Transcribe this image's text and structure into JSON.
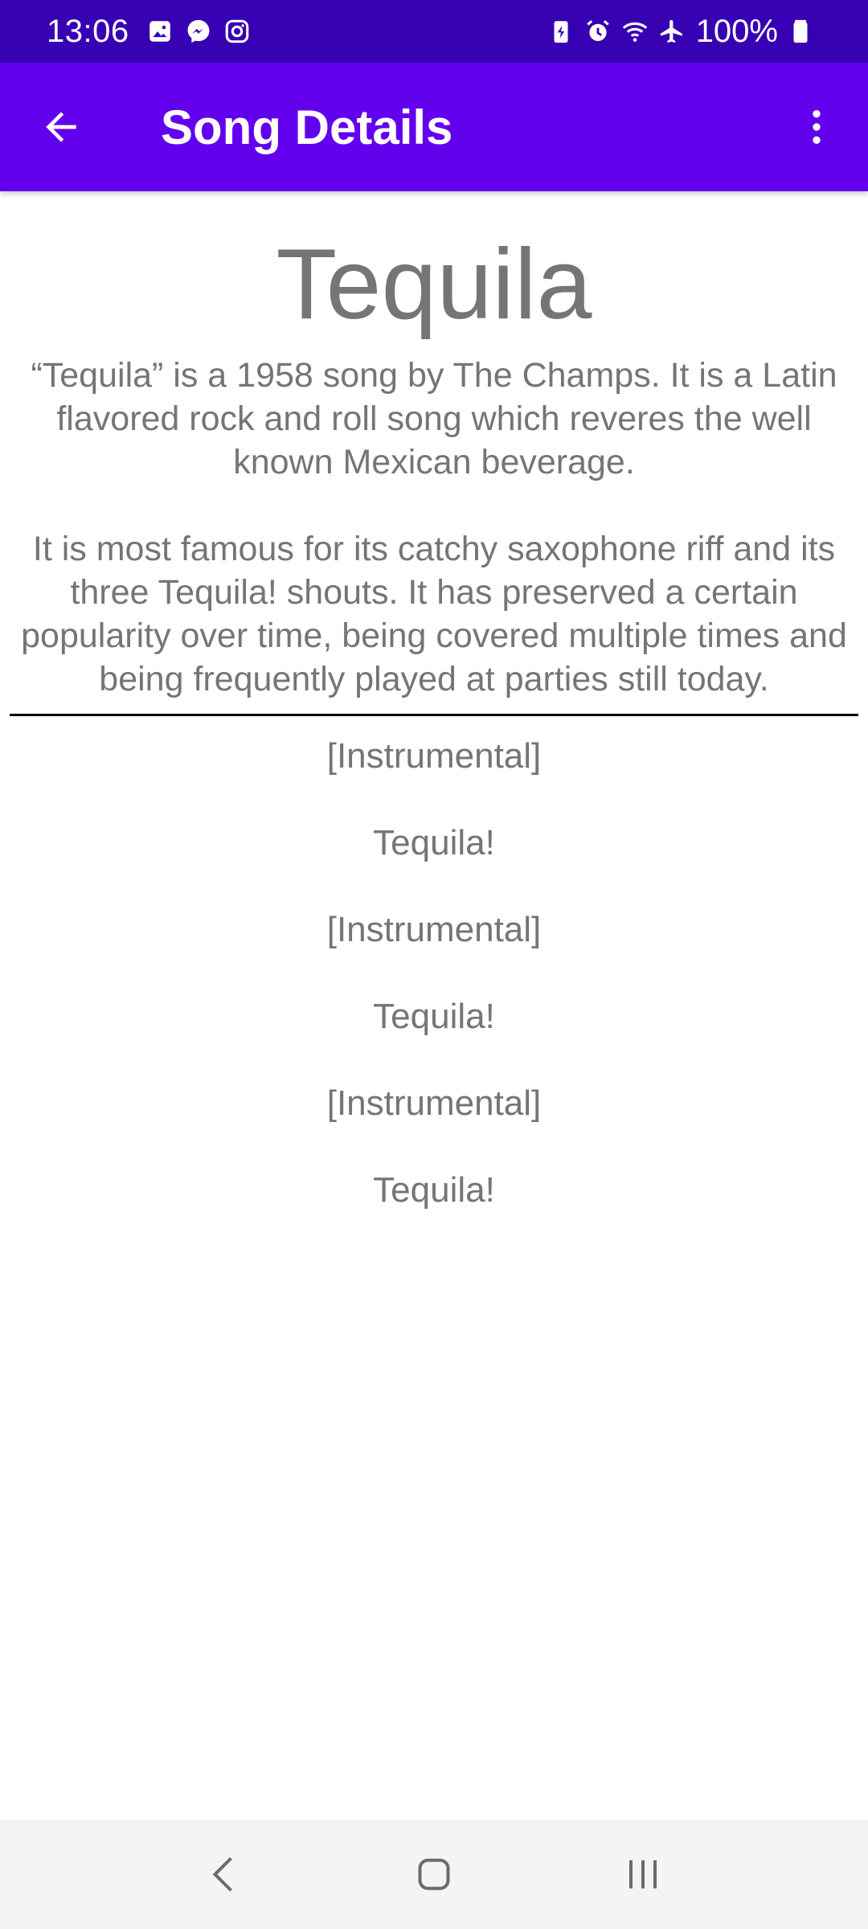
{
  "status_bar": {
    "time": "13:06",
    "battery": "100%",
    "left_icons": [
      "gallery-icon",
      "messenger-icon",
      "instagram-icon"
    ],
    "right_icons": [
      "battery-saver-icon",
      "alarm-icon",
      "wifi-icon",
      "airplane-icon",
      "battery-icon"
    ]
  },
  "app_bar": {
    "title": "Song Details",
    "back_icon": "arrow-back-icon",
    "menu_icon": "more-vert-icon",
    "background": "#6200ee"
  },
  "song": {
    "title": "Tequila",
    "description_1": "“Tequila” is a 1958 song by The Champs. It is a Latin flavored rock and roll song which reveres the well known Mexican beverage.",
    "description_2": "It is most famous for its catchy saxophone riff and its three Tequila! shouts. It has preserved a certain popularity over time, being covered multiple times and being frequently played at parties still today.",
    "lyrics": [
      "[Instrumental]",
      "Tequila!",
      "[Instrumental]",
      "Tequila!",
      "[Instrumental]",
      "Tequila!"
    ]
  },
  "nav_bar": {
    "icons": [
      "nav-back-icon",
      "home-icon",
      "recents-icon"
    ]
  },
  "colors": {
    "status_bar": "#3700b3",
    "app_bar": "#6200ee",
    "text_gray": "#757575"
  }
}
